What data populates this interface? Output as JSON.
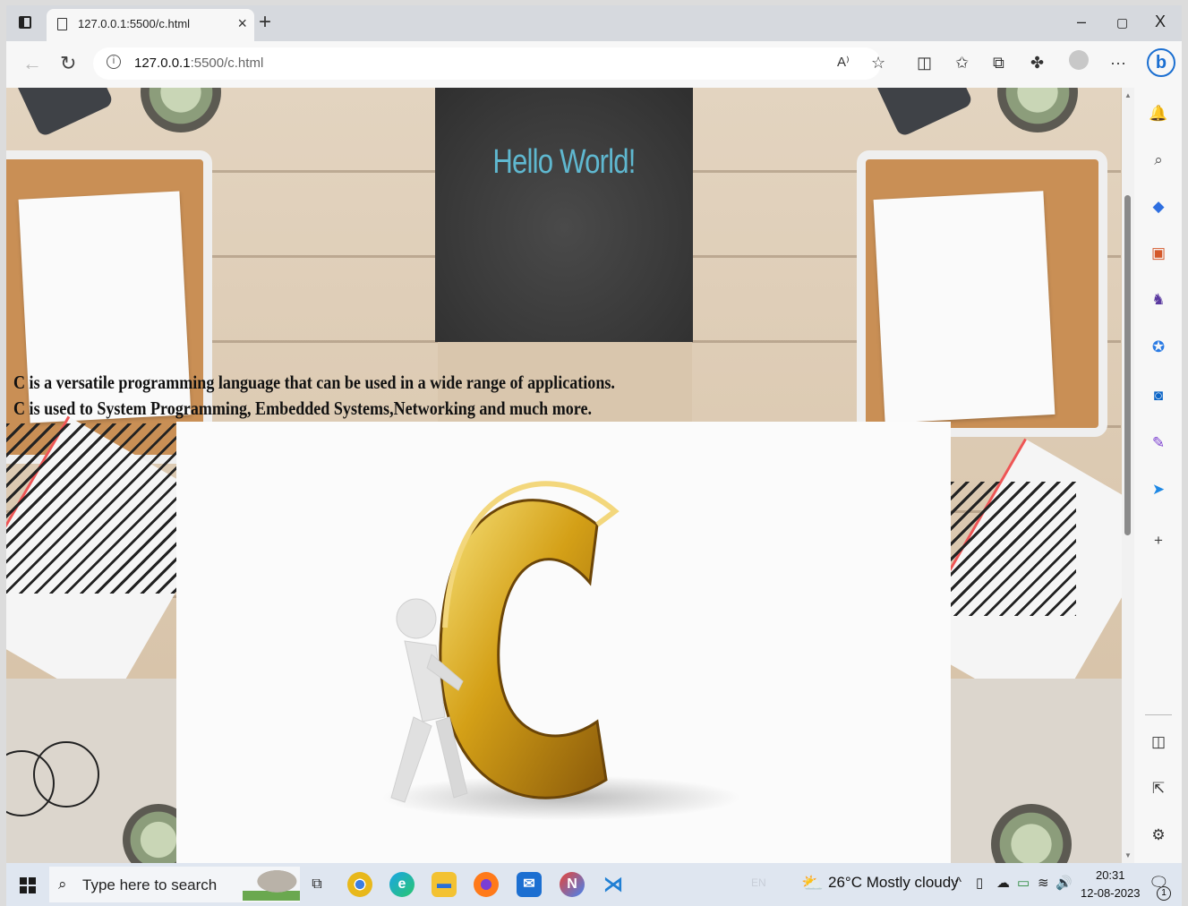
{
  "browser": {
    "tab_title": "127.0.0.1:5500/c.html",
    "tab_close": "×",
    "new_tab": "+",
    "window_controls": [
      "–",
      "▢",
      "X"
    ],
    "url_host": "127.0.0.1",
    "url_rest": ":5500/c.html",
    "toolbar_icons": [
      "read-aloud-icon",
      "favorite-star-icon",
      "split-screen-icon",
      "favorites-icon",
      "collections-icon",
      "extensions-icon",
      "profile-icon",
      "more-icon"
    ],
    "more_label": "···",
    "read_aloud_label": "A⁾"
  },
  "page": {
    "heading": "Hello World!",
    "lines": [
      "C is a versatile programming language that can be used in a wide range of applications.",
      "C is used to System Programming, Embedded Systems,Networking and much more."
    ],
    "c_image_letter": "C"
  },
  "sidebar": {
    "icons": [
      "bell-icon",
      "search-icon",
      "tag-icon",
      "briefcase-icon",
      "chess-icon",
      "copilot-icon",
      "outlook-icon",
      "designer-icon",
      "send-icon",
      "add-icon"
    ],
    "bottom_icons": [
      "sidebar-toggle-icon",
      "external-link-icon",
      "settings-icon"
    ]
  },
  "taskbar": {
    "search_placeholder": "Type here to search",
    "weather": "26°C  Mostly cloudy",
    "language": "EN",
    "time": "20:31",
    "date": "12-08-2023",
    "notification_count": "1",
    "apps": [
      "task-view-icon",
      "chrome-icon",
      "edge-icon",
      "file-explorer-icon",
      "firefox-icon",
      "mail-icon",
      "notion-icon",
      "vscode-icon"
    ]
  },
  "colors": {
    "hello_text": "#5fb8d0",
    "bing_blue": "#1b6fd1",
    "gold": "#d4a017"
  }
}
